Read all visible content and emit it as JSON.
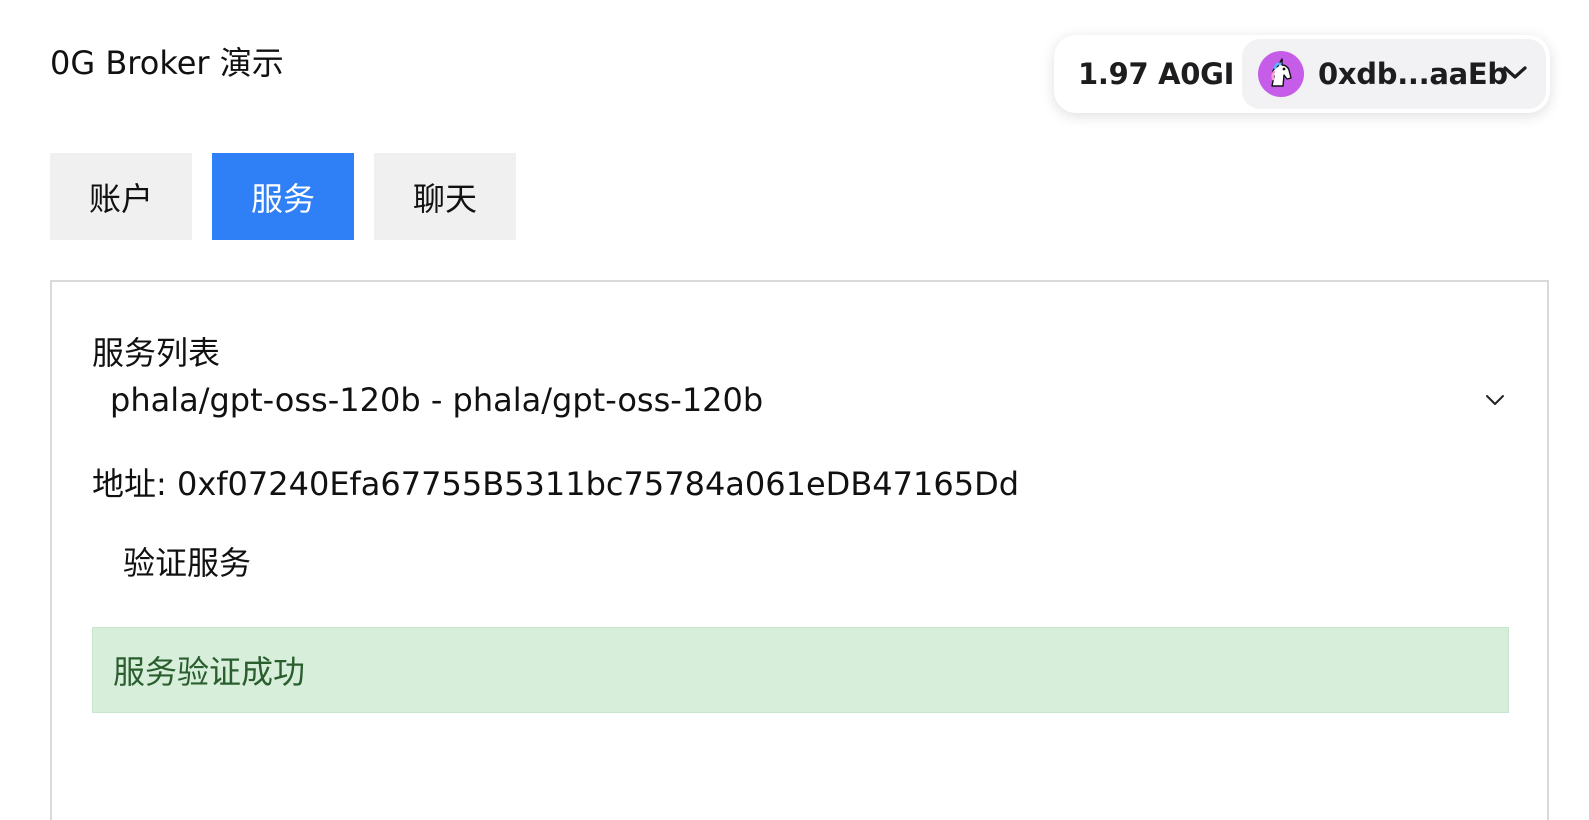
{
  "app": {
    "title": "0G Broker 演示"
  },
  "wallet": {
    "balance": "1.97 A0GI",
    "address": "0xdb...aaEb",
    "avatar_icon": "unicorn-icon",
    "avatar_color": "#c55de8"
  },
  "tabs": [
    {
      "label": "账户",
      "active": false
    },
    {
      "label": "服务",
      "active": true
    },
    {
      "label": "聊天",
      "active": false
    }
  ],
  "services": {
    "section_label": "服务列表",
    "selected_service": "phala/gpt-oss-120b - phala/gpt-oss-120b",
    "address_line": "地址: 0xf07240Efa67755B5311bc75784a061eDB47165Dd",
    "verify_button": "验证服务",
    "success_message": "服务验证成功"
  },
  "colors": {
    "accent": "#2f7ff7",
    "success_bg": "#d6eeda",
    "success_text": "#2a5e2e"
  }
}
